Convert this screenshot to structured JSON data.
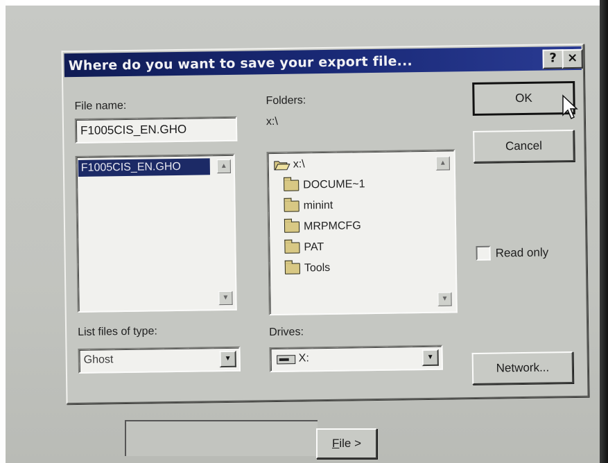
{
  "dialog": {
    "title": "Where do you want to save your export file...",
    "help_label": "?",
    "close_label": "×",
    "file_name_label": "File name:",
    "file_name_value": "F1005CIS_EN.GHO",
    "file_list": [
      "F1005CIS_EN.GHO"
    ],
    "folders_label": "Folders:",
    "current_folder": "x:\\",
    "folder_tree": [
      "x:\\",
      "DOCUME~1",
      "minint",
      "MRPMCFG",
      "PAT",
      "Tools"
    ],
    "ok_label": "OK",
    "cancel_label": "Cancel",
    "read_only_label": "Read only",
    "types_label": "List files of type:",
    "types_value": "Ghost",
    "drives_label": "Drives:",
    "drives_value": "X:",
    "network_label": "Network..."
  },
  "below": {
    "file_button_prefix": "",
    "file_button_label": "File >",
    "file_button_underlined": "F",
    "file_button_rest": "ile >"
  },
  "colors": {
    "titlebar": "#1a2a78",
    "dialog_face": "#c5c7c2",
    "selection": "#1c2a66"
  },
  "icons": {
    "open_folder": "open-folder-icon",
    "folder": "folder-icon",
    "drive": "drive-icon",
    "cursor": "mouse-cursor-icon"
  }
}
